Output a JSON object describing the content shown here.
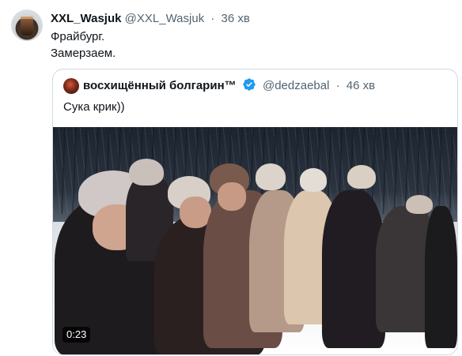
{
  "tweet": {
    "author_name": "XXL_Wasjuk",
    "author_handle": "@XXL_Wasjuk",
    "dot": "·",
    "time": "36 хв",
    "text_lines": [
      "Фрайбург.",
      "Замерзаем."
    ]
  },
  "quoted_tweet": {
    "author_name": "восхищённый болгарин™",
    "author_handle": "@dedzaebal",
    "dot": "·",
    "time": "46 хв",
    "text": "Сука крик))",
    "verified_color": "#1d9bf0",
    "video": {
      "duration": "0:23"
    }
  },
  "icons": {
    "verified": "verified-badge-icon"
  }
}
